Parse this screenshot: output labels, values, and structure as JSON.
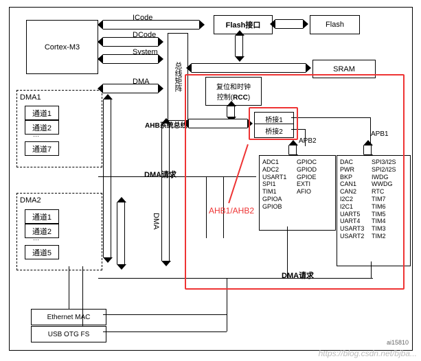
{
  "buses": {
    "icode": "ICode",
    "dcode": "DCode",
    "system": "System",
    "dma": "DMA",
    "matrix_vertical_label": "总线矩阵",
    "dma_side_label": "DMA",
    "ahb_bus": "AHB系统总线"
  },
  "blocks": {
    "cortex": "Cortex-M3",
    "dma1": "DMA1",
    "dma2": "DMA2",
    "ch1": "通道1",
    "ch2": "通道2",
    "ch7": "通道7",
    "ch5": "通道5",
    "flash_if": "Flash接口",
    "flash": "Flash",
    "sram": "SRAM",
    "rcc": "复位和时钟\n控制(RCC)",
    "bridge1": "桥接1",
    "bridge2": "桥接2",
    "apb2": "APB2",
    "apb1": "APB1",
    "eth": "Ethernet MAC",
    "usb": "USB OTG FS"
  },
  "peripherals": {
    "apb2_left": [
      "ADC1",
      "ADC2",
      "USART1",
      "SPI1",
      "TIM1",
      "GPIOA",
      "GPIOB"
    ],
    "apb2_right": [
      "GPIOC",
      "GPIOD",
      "GPIOE",
      "EXTI",
      "AFIO"
    ],
    "apb1_left": [
      "DAC",
      "PWR",
      "BKP",
      "CAN1",
      "CAN2",
      "I2C2",
      "I2C1",
      "UART5",
      "UART4",
      "USART3",
      "USART2"
    ],
    "apb1_right": [
      "SPI3/I2S",
      "SPI2/I2S",
      "IWDG",
      "WWDG",
      "RTC",
      "TIM7",
      "TIM6",
      "TIM5",
      "TIM4",
      "TIM3",
      "TIM2"
    ]
  },
  "labels": {
    "dma_req1": "DMA请求",
    "dma_req2": "DMA请求"
  },
  "annotations": {
    "red_text": "AHB1/AHB2"
  },
  "meta": {
    "watermark": "https://blog.csdn.net/bjba...",
    "doc_id": "ai15810"
  }
}
